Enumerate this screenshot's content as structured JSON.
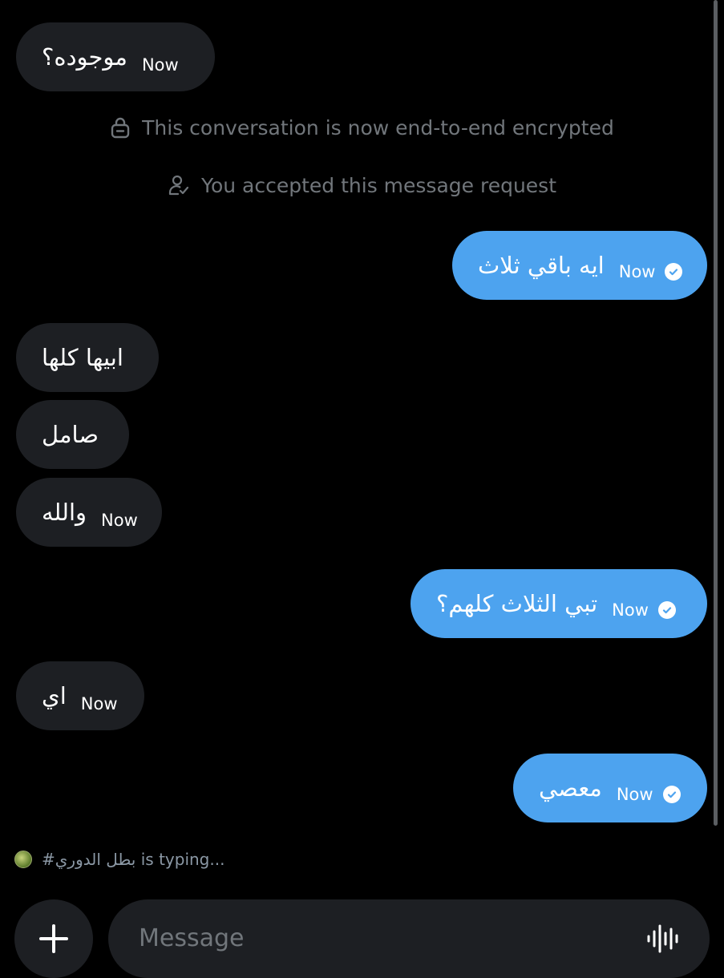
{
  "conversation": {
    "system_notices": [
      {
        "icon": "lock-icon",
        "text": "This conversation is now end-to-end encrypted"
      },
      {
        "icon": "user-check-icon",
        "text": "You accepted this message request"
      }
    ],
    "messages": [
      {
        "direction": "incoming",
        "text": "موجوده؟",
        "time": "Now"
      },
      {
        "direction": "outgoing",
        "text": "ايه باقي ثلاث",
        "time": "Now",
        "status": "read"
      },
      {
        "direction": "incoming",
        "text": "ابيها كلها"
      },
      {
        "direction": "incoming",
        "text": "صامل"
      },
      {
        "direction": "incoming",
        "text": "والله",
        "time": "Now"
      },
      {
        "direction": "outgoing",
        "text": "تبي الثلاث كلهم؟",
        "time": "Now",
        "status": "read"
      },
      {
        "direction": "incoming",
        "text": "اي",
        "time": "Now"
      },
      {
        "direction": "outgoing",
        "text": "معصي",
        "time": "Now",
        "status": "read"
      }
    ],
    "typing_indicator": "#بطل الدوري is typing..."
  },
  "composer": {
    "placeholder": "Message",
    "add_icon": "plus-icon",
    "voice_icon": "waveform-icon"
  },
  "colors": {
    "background": "#000000",
    "incoming_bubble": "#1d1f23",
    "outgoing_bubble": "#4da3ef",
    "muted_text": "#71767b"
  }
}
